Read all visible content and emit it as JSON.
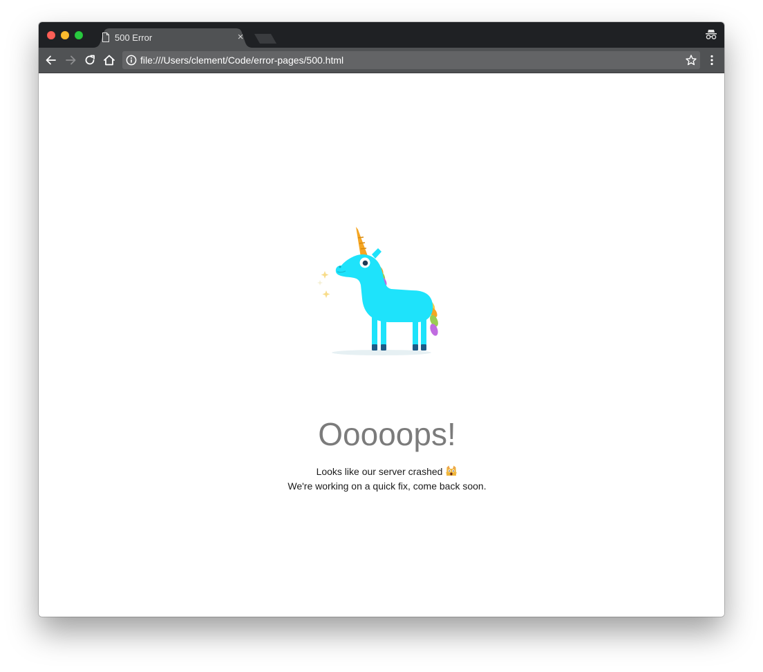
{
  "browser": {
    "tab": {
      "title": "500 Error",
      "icon": "document-icon",
      "close_glyph": "×"
    },
    "address_bar": {
      "url": "file:///Users/clement/Code/error-pages/500.html"
    },
    "icons": {
      "back": "arrow-left-icon",
      "forward": "arrow-right-icon",
      "reload": "reload-icon",
      "home": "home-icon",
      "info": "info-icon",
      "bookmark": "star-icon",
      "menu": "kebab-menu-icon",
      "incognito": "incognito-icon"
    }
  },
  "page": {
    "headline": "Ooooops!",
    "message_line1": "Looks like our server crashed",
    "message_line1_emoji": "scream-cat-emoji",
    "message_line2": "We're working on a quick fix, come back soon.",
    "illustration": "unicorn-illustration"
  },
  "colors": {
    "titlebar": "#1f2124",
    "tab_active": "#505254",
    "toolbar": "#505254",
    "omnibox": "#636466",
    "headline": "#7b7b7b",
    "unicorn_body": "#1ee3fb",
    "unicorn_horn": "#f5a623"
  }
}
